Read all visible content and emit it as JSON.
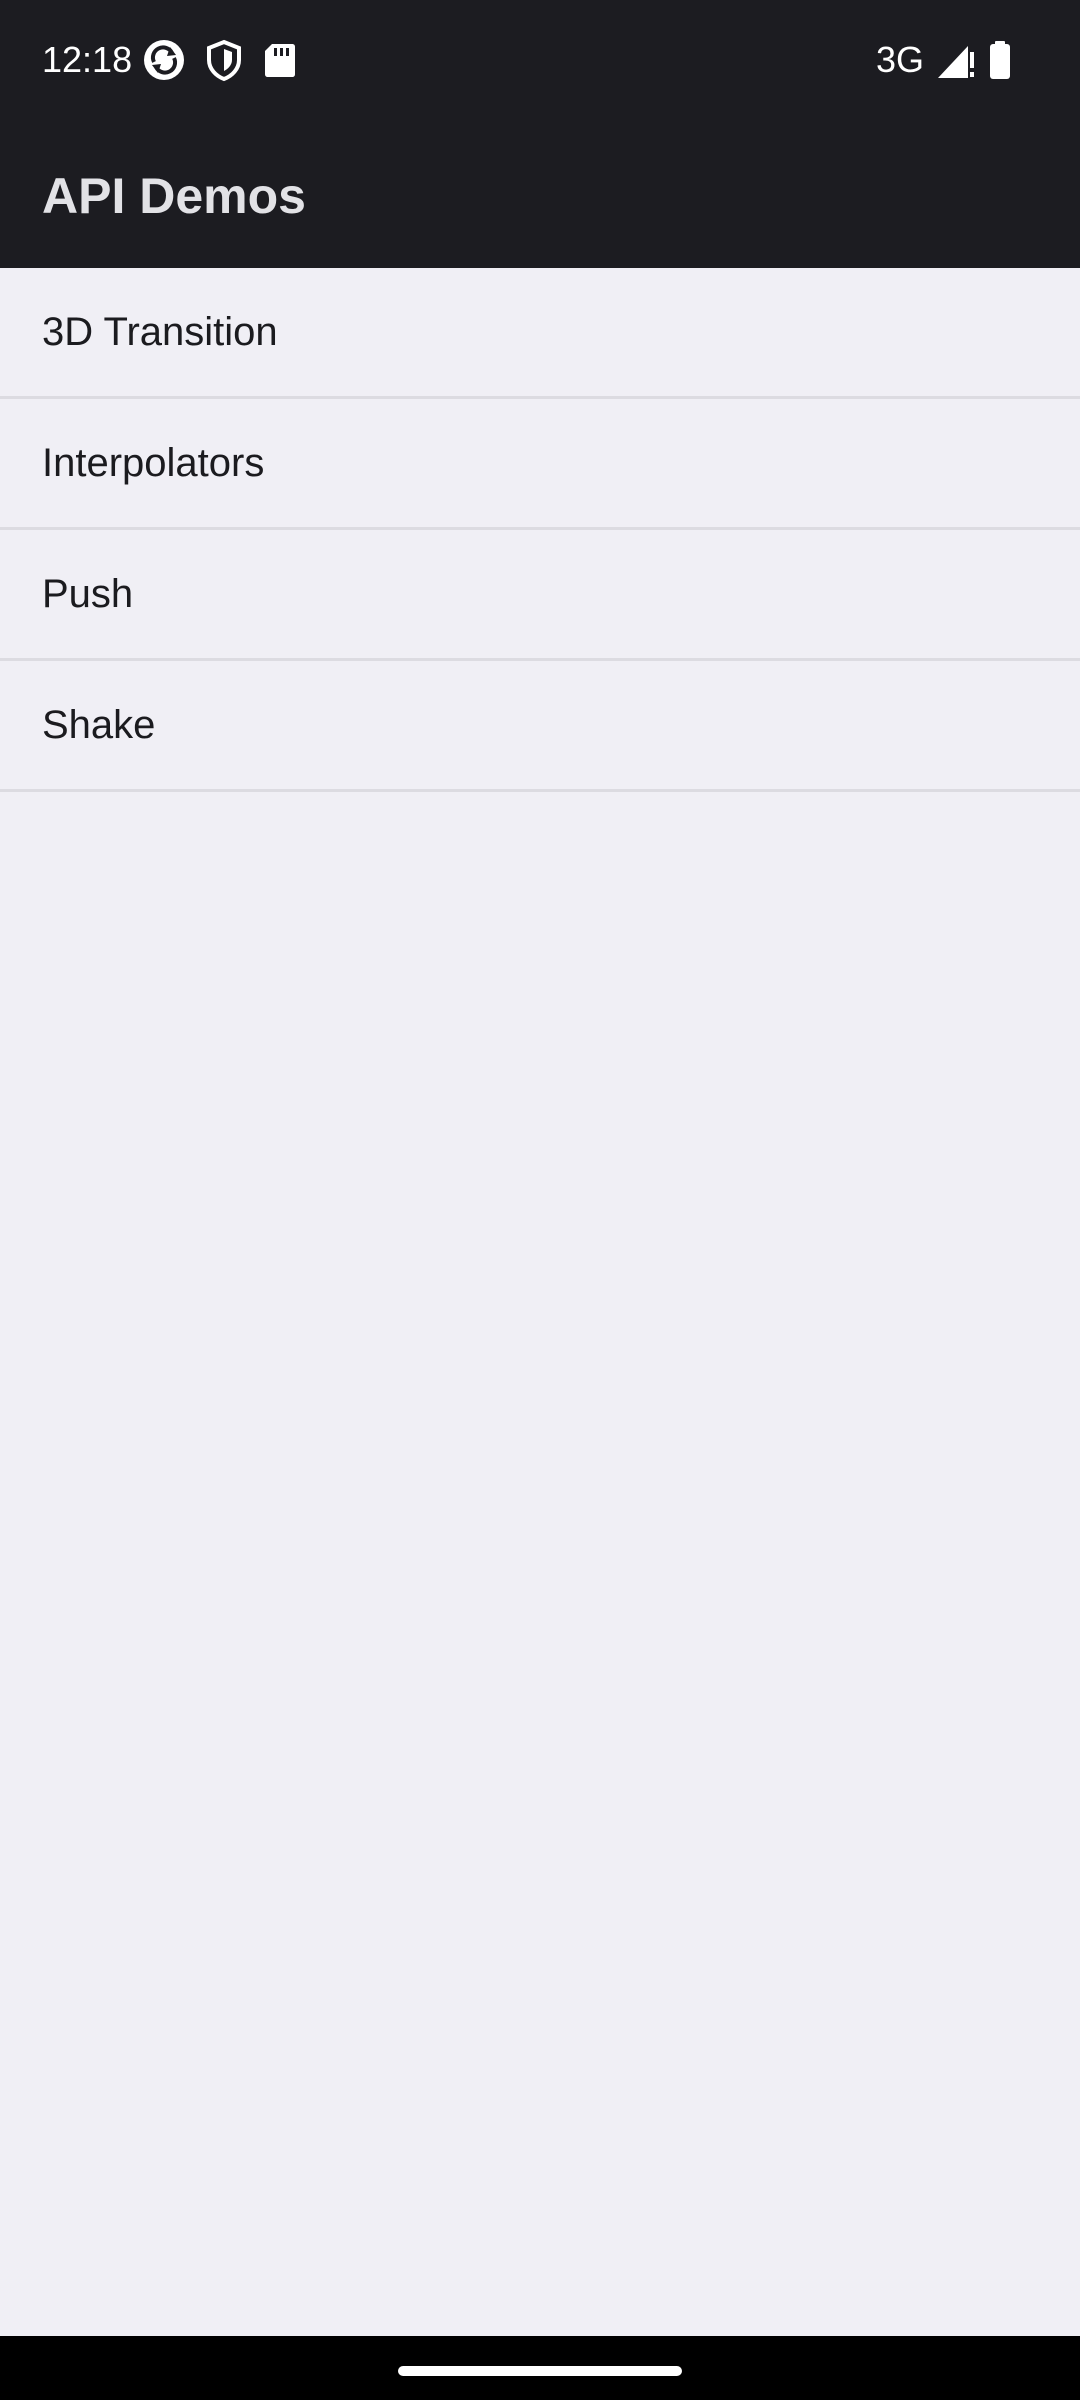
{
  "status_bar": {
    "time": "12:18",
    "network": "3G",
    "icons": [
      "sync-icon",
      "shield-icon",
      "sd-card-icon",
      "signal-icon",
      "battery-icon"
    ]
  },
  "app_bar": {
    "title": "API Demos"
  },
  "list": {
    "items": [
      {
        "label": "3D Transition"
      },
      {
        "label": "Interpolators"
      },
      {
        "label": "Push"
      },
      {
        "label": "Shake"
      }
    ]
  },
  "colors": {
    "app_bar_bg": "#1C1C21",
    "page_bg": "#F0EFF5",
    "divider": "#DCDBE1",
    "text": "#1B1B1F",
    "title_text": "#E2E2E6"
  }
}
